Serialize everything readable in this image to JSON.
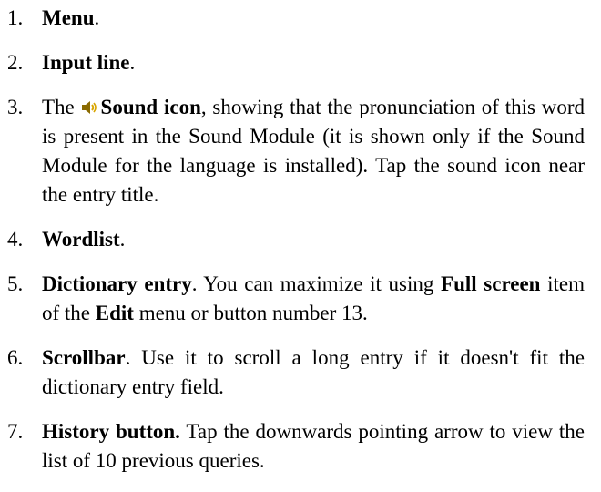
{
  "items": [
    {
      "number": "1.",
      "title": "Menu",
      "after": "."
    },
    {
      "number": "2.",
      "title": "Input line",
      "after": "."
    },
    {
      "number": "3.",
      "before": "The ",
      "icon": "speaker-icon",
      "title": "Sound icon",
      "after": ", showing that the pronunciation of this word is present in the Sound Module (it is shown only if the Sound Module for the language is installed). Tap the sound icon near the entry title."
    },
    {
      "number": "4.",
      "title": "Wordlist",
      "after": "."
    },
    {
      "number": "5.",
      "title": "Dictionary entry",
      "after": ". You can maximize it using ",
      "bold2": "Full screen",
      "after2": " item of the ",
      "bold3": "Edit",
      "after3": " menu or button number 13."
    },
    {
      "number": "6.",
      "title": "Scrollbar",
      "after": ". Use it to scroll a long entry if it doesn't fit the dictionary entry field."
    },
    {
      "number": "7.",
      "title": "History button.",
      "after": " Tap the downwards pointing arrow to view the list of 10 previous queries."
    }
  ],
  "colors": {
    "text": "#000000",
    "speaker_body": "#8a6a00",
    "speaker_waves": "#d9a500"
  }
}
